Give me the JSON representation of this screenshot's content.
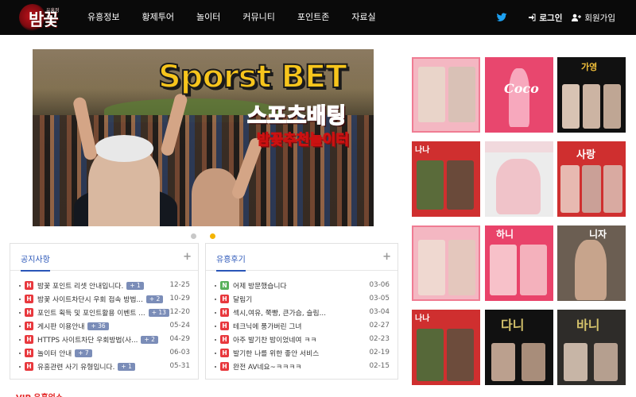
{
  "site": {
    "logo_text": "밤꽃",
    "logo_small": "유흥정보"
  },
  "nav": {
    "items": [
      "유흥정보",
      "황제투어",
      "놀이터",
      "커뮤니티",
      "포인트존",
      "자료실"
    ],
    "login": "로그인",
    "signup": "회원가입"
  },
  "banner": {
    "title": "Sporst BET",
    "subtitle": "스포츠배팅",
    "tagline": "밤꽃추천놀이터",
    "slides": 2,
    "active_slide": 2
  },
  "notice": {
    "title": "공지사항",
    "more": "+",
    "items": [
      {
        "text": "밤꽃 포인트 리셋 안내입니다.",
        "comments": "+ 1",
        "date": "12-25"
      },
      {
        "text": "밤꽃 사이트차단시 우회 접속 방법...",
        "comments": "+ 2",
        "date": "10-29"
      },
      {
        "text": "포인트 획득 및 포인트활용 이벤트 ...",
        "comments": "+ 13",
        "date": "12-20"
      },
      {
        "text": "게시판 이용안내",
        "comments": "+ 36",
        "date": "05-24"
      },
      {
        "text": "HTTPS 사이트차단 우회방법(사...",
        "comments": "+ 2",
        "date": "04-29"
      },
      {
        "text": "놀이터 안내",
        "comments": "+ 7",
        "date": "06-03"
      },
      {
        "text": "유흥관련 사기 유형입니다.",
        "comments": "+ 1",
        "date": "05-31"
      }
    ]
  },
  "review": {
    "title": "유흥후기",
    "more": "+",
    "items": [
      {
        "badge": "N",
        "text": "어제 방문했습니다",
        "date": "03-06"
      },
      {
        "badge": "H",
        "text": "달림기",
        "date": "03-05"
      },
      {
        "badge": "H",
        "text": "섹시,여유, 쭉빵, 큰가슴, 슬림...",
        "date": "03-04"
      },
      {
        "badge": "H",
        "text": "테크닉에 풍가버린 그녀",
        "date": "02-27"
      },
      {
        "badge": "H",
        "text": "아주 발기찬 밤이었네여 ㅋㅋ",
        "date": "02-23"
      },
      {
        "badge": "H",
        "text": "발기한 나를 위한 좋안 서비스",
        "date": "02-19"
      },
      {
        "badge": "H",
        "text": "완전 AV네요~ㅋㅋㅋㅋ",
        "date": "02-15"
      }
    ]
  },
  "vip": "VIP 유흥업소",
  "ads": [
    {
      "label": ""
    },
    {
      "label": "Coco"
    },
    {
      "label": "가영"
    },
    {
      "label": "나나"
    },
    {
      "label": ""
    },
    {
      "label": "사랑"
    },
    {
      "label": ""
    },
    {
      "label": "하니"
    },
    {
      "label": "니자"
    },
    {
      "label": "나나"
    },
    {
      "label": "다니"
    },
    {
      "label": "바니"
    }
  ],
  "colors": {
    "topbar": "#0a0a0a",
    "accent_blue": "#2a56b8",
    "hot_badge": "#e8383d",
    "new_badge": "#58b15c",
    "dot_active": "#f4b400"
  }
}
